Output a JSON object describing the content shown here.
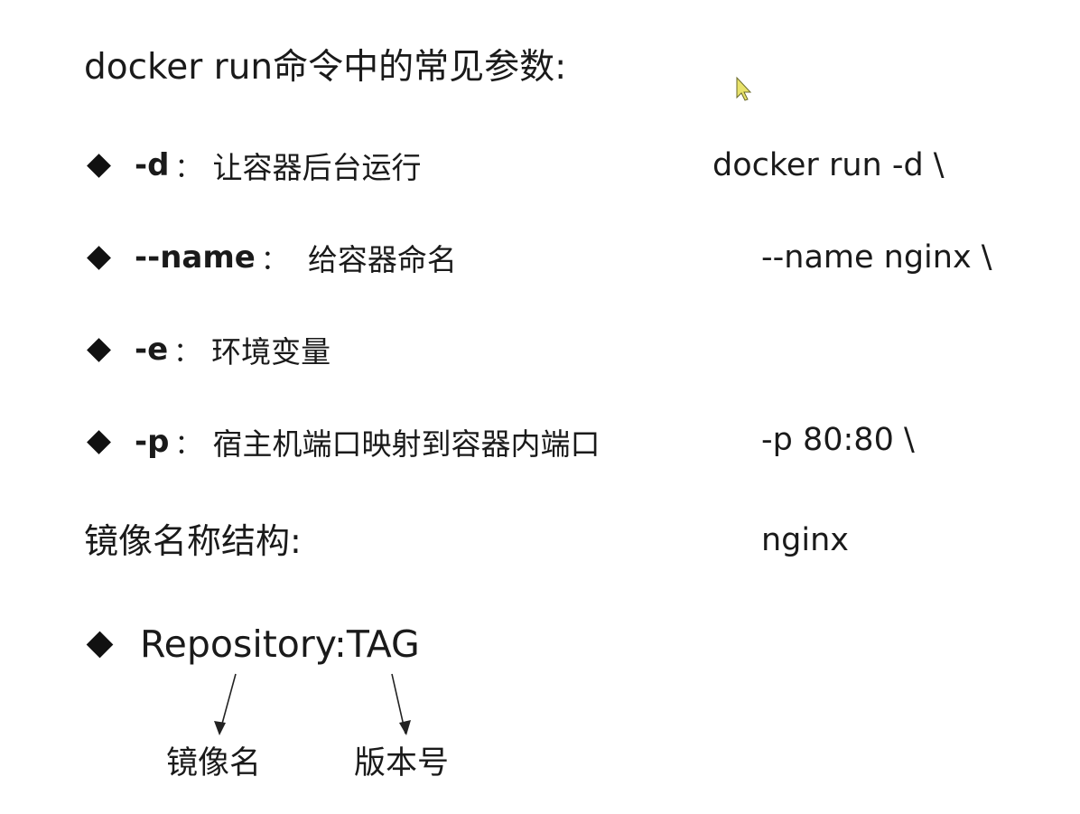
{
  "title": "docker run命令中的常见参数:",
  "params": [
    {
      "flag": "-d",
      "colon": "：",
      "desc": "让容器后台运行"
    },
    {
      "flag": "--name",
      "colon": "：",
      "desc": "给容器命名"
    },
    {
      "flag": "-e",
      "colon": "：",
      "desc": "环境变量"
    },
    {
      "flag": "-p",
      "colon": "：",
      "desc": "宿主机端口映射到容器内端口"
    }
  ],
  "command_lines": [
    "docker run -d \\",
    "--name nginx \\",
    "-p 80:80 \\",
    "nginx"
  ],
  "image_name_heading": "镜像名称结构:",
  "repo_tag": "Repository:TAG",
  "repo_labels": [
    "镜像名",
    "版本号"
  ],
  "icons": {
    "bullet": "diamond-bullet-icon",
    "cursor": "mouse-cursor-icon",
    "arrow": "down-arrow-icon"
  },
  "colors": {
    "text": "#1a1a1a",
    "cursor_fill": "#e8e26a"
  }
}
